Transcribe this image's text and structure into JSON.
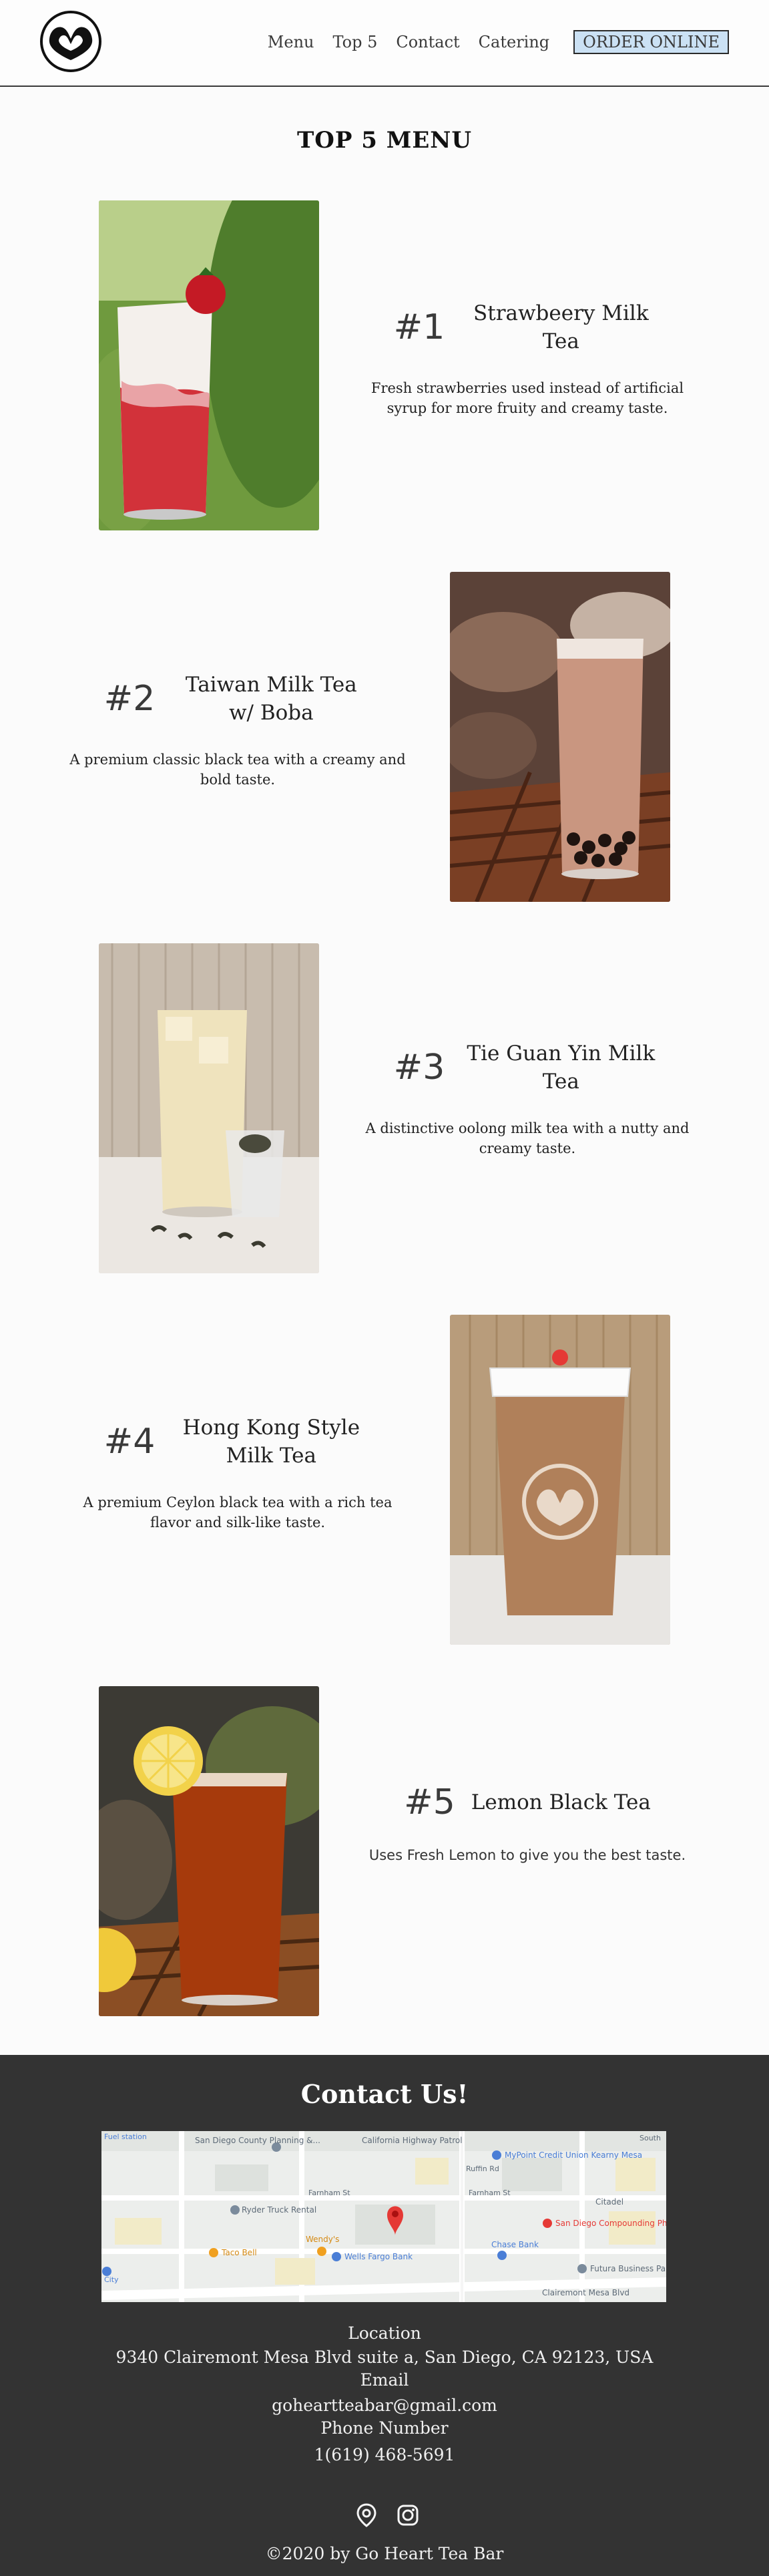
{
  "header": {
    "nav": [
      "Menu",
      "Top 5",
      "Contact",
      "Catering"
    ],
    "order_label": "ORDER ONLINE"
  },
  "main": {
    "title": "TOP 5 MENU",
    "items": [
      {
        "rank": "#1",
        "name": "Strawbeery Milk Tea",
        "desc": "Fresh strawberries used instead of artificial syrup for more fruity and creamy taste."
      },
      {
        "rank": "#2",
        "name": "Taiwan Milk Tea w/ Boba",
        "desc": "A premium classic black tea with a creamy and bold taste."
      },
      {
        "rank": "#3",
        "name": "Tie Guan Yin Milk Tea",
        "desc": "A distinctive oolong milk tea with a nutty and creamy taste."
      },
      {
        "rank": "#4",
        "name": "Hong Kong Style Milk Tea",
        "desc": "A premium Ceylon black tea with a rich tea flavor and silk-like taste."
      },
      {
        "rank": "#5",
        "name": "Lemon Black Tea",
        "desc": "Uses Fresh Lemon to give you the best taste."
      }
    ]
  },
  "footer": {
    "title": "Contact Us!",
    "map_labels": {
      "county": "San Diego County Planning &...",
      "highway": "California Highway Patrol",
      "credit": "MyPoint Credit Union Kearny Mesa",
      "truck": "Ryder Truck Rental",
      "pharmacy": "San Diego Compounding Pharmacy",
      "taco": "Taco Bell",
      "wendys": "Wendy's",
      "wells": "Wells Fargo Bank",
      "chase": "Chase Bank",
      "futura": "Futura Business Park",
      "road": "Clairemont Mesa Blvd",
      "farnham": "Farnham St",
      "ruffin": "Ruffin Rd",
      "citadel": "Citadel",
      "fuel": "Fuel station",
      "south": "South",
      "city": "City"
    },
    "location_label": "Location",
    "address": "9340 Clairemont Mesa Blvd suite a, San Diego, CA 92123, USA",
    "email_label": "Email",
    "email": "goheartteabar@gmail.com",
    "phone_label": "Phone Number",
    "phone": "1(619) 468-5691",
    "copyright": "©2020 by Go Heart Tea Bar"
  },
  "colors": {
    "footer_bg": "#333333",
    "order_button_bg": "#cbe1f4",
    "map_pin": "#e53935"
  },
  "icons": [
    "heart-hands-logo",
    "location-pin-icon",
    "instagram-icon"
  ]
}
